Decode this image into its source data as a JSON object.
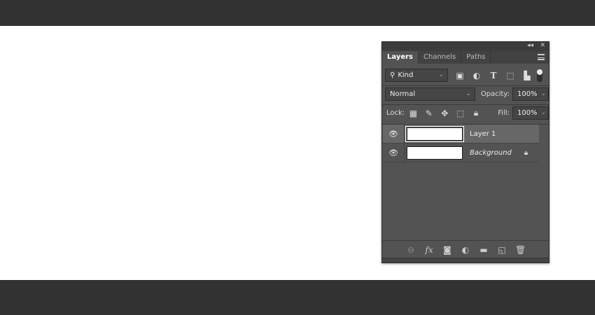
{
  "panel": {
    "tabs": [
      {
        "label": "Layers",
        "active": true
      },
      {
        "label": "Channels"
      },
      {
        "label": "Paths"
      }
    ],
    "filter": {
      "label": "Kind"
    },
    "blend_mode": "Normal",
    "opacity_label": "Opacity:",
    "opacity": "100%",
    "lock_label": "Lock:",
    "fill_label": "Fill:",
    "fill": "100%",
    "layers": [
      {
        "name": "Layer 1",
        "selected": true,
        "visible": true
      },
      {
        "name": "Background",
        "locked": true,
        "visible": true
      }
    ]
  },
  "colors": {
    "chrome": "#323232",
    "panel": "#535353",
    "selected_row": "#676767"
  }
}
